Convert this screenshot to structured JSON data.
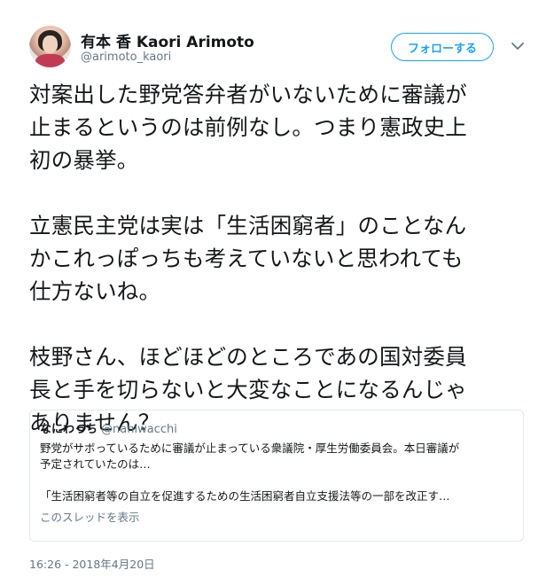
{
  "author": {
    "display_name": "有本 香 Kaori Arimoto",
    "handle": "@arimoto_kaori"
  },
  "follow_button": {
    "label": "フォローする"
  },
  "menu": {
    "icon": "chevron-down-icon"
  },
  "tweet": {
    "lines": [
      "対案出した野党答弁者がいないために審議が",
      "止まるというのは前例なし。つまり憲政史上",
      "初の暴挙。",
      "",
      "立憲民主党は実は「生活困窮者」のことなん",
      "かこれっぽっちも考えていないと思われても",
      "仕方ないね。",
      "",
      "枝野さん、ほどほどのところであの国対委員",
      "長と手を切らないと大変なことになるんじゃ",
      "ありません？"
    ]
  },
  "quote": {
    "name": "なにわっち",
    "handle": "@naniwacchi",
    "line1": "野党がサボっているために審議が止まっている衆議院・厚生労働委員会。本日審議が",
    "line2": "予定されていたのは…",
    "line3": "「生活困窮者等の自立を促進するための生活困窮者自立支援法等の一部を改正す…",
    "thread_link": "このスレッドを表示"
  },
  "timestamp": "16:26 - 2018年4月20日",
  "colors": {
    "accent": "#1da1f2",
    "text": "#14171a",
    "muted": "#657786",
    "border": "#e1e8ed"
  }
}
